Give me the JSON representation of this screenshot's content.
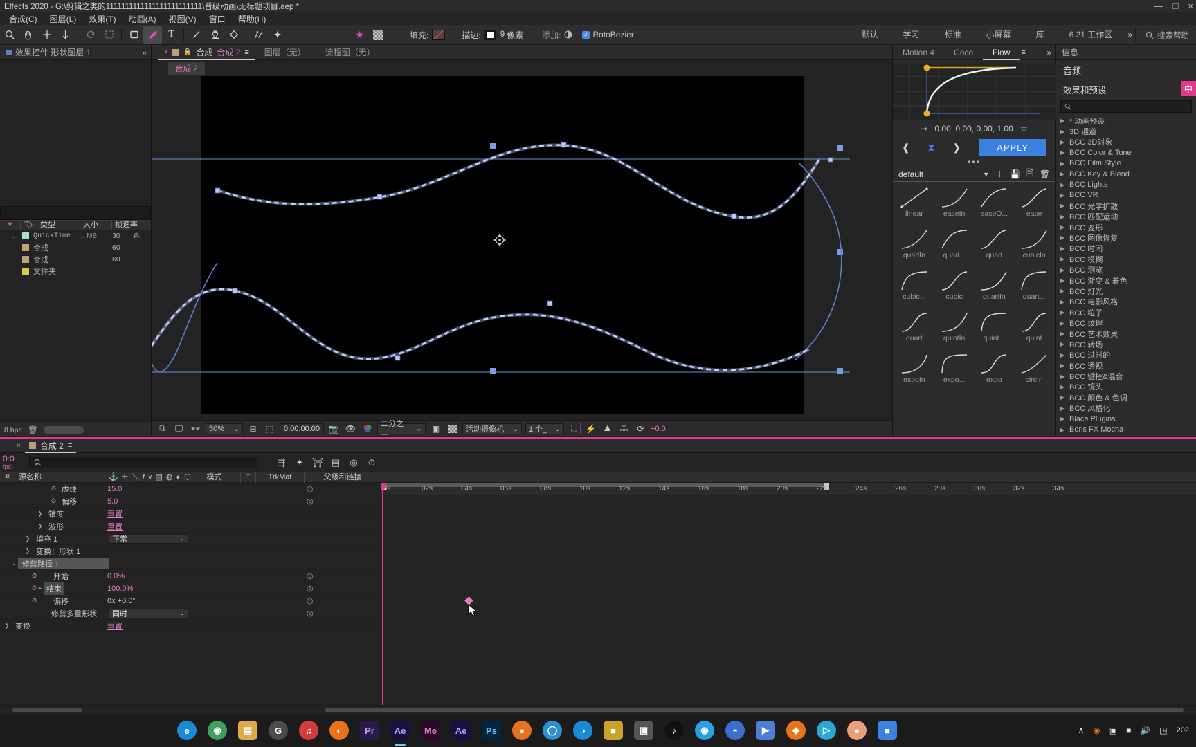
{
  "window": {
    "title": "Effects 2020 - G:\\剪辑之类的1111111111111111111111111\\晋级动画\\无标题项目.aep *",
    "buttons": [
      "—",
      "□",
      "×"
    ]
  },
  "menubar": {
    "items": [
      "合成(C)",
      "图层(L)",
      "效果(T)",
      "动画(A)",
      "视图(V)",
      "窗口",
      "帮助(H)"
    ]
  },
  "toolbar": {
    "tools": [
      {
        "name": "zoom-tool",
        "glyph": "⌕"
      },
      {
        "name": "hand-tool",
        "glyph": "✋"
      },
      {
        "name": "orbit-tool",
        "glyph": "✣"
      },
      {
        "name": "pan-behind-tool",
        "glyph": "↧"
      },
      {
        "name": "rotation-tool",
        "glyph": "↺"
      },
      {
        "name": "region-of-interest-tool",
        "glyph": "⛶"
      },
      {
        "name": "rectangle-tool",
        "glyph": "□"
      },
      {
        "name": "pen-tool",
        "glyph": "✒"
      },
      {
        "name": "type-tool",
        "glyph": "T"
      },
      {
        "name": "brush-tool",
        "glyph": "╱"
      },
      {
        "name": "clone-stamp-tool",
        "glyph": "⚓"
      },
      {
        "name": "eraser-tool",
        "glyph": "◆"
      },
      {
        "name": "roto-brush-tool",
        "glyph": "✎"
      },
      {
        "name": "puppet-pin-tool",
        "glyph": "✦"
      }
    ],
    "fill_label": "填充:",
    "stroke_label": "描边:",
    "stroke_width": "9",
    "stroke_unit": "像素",
    "add_label": "添加:",
    "rotobezier_label": "RotoBezier",
    "rotobezier_checked": true
  },
  "workspaces": {
    "items": [
      "默认",
      "学习",
      "标准",
      "小屏幕",
      "库",
      "6.21 工作区"
    ],
    "search_placeholder": "搜索帮助"
  },
  "effect_controls": {
    "tab_label": "效果控件 形状图层 1",
    "expand_glyph": "»"
  },
  "project_panel": {
    "columns": [
      "类型",
      "大小",
      "帧速率"
    ],
    "rows": [
      {
        "color": "#a8ded6",
        "type": "QuickTime",
        "size": "... MB",
        "fps": "30"
      },
      {
        "color": "#c0a275",
        "type": "合成",
        "size": "",
        "fps": "60"
      },
      {
        "color": "#c0a275",
        "type": "合成",
        "size": "",
        "fps": "60"
      },
      {
        "color": "#d6c84a",
        "type": "文件夹",
        "size": "",
        "fps": ""
      }
    ],
    "bit_depth": "8 bpc"
  },
  "comp_viewer": {
    "tabs": [
      {
        "label_prefix": "合成",
        "label_name": "合成 2",
        "active": true
      },
      {
        "label": "图层（无）",
        "active": false
      },
      {
        "label": "流程图（无）",
        "active": false
      }
    ],
    "breadcrumb": "合成 2",
    "bottom": {
      "zoom": "50%",
      "time": "0:00:00:00",
      "resolution": "二分之一",
      "camera": "活动摄像机",
      "views": "1 个_",
      "exposure": "+0.0"
    }
  },
  "flow_panel": {
    "tabs": [
      {
        "label": "Motion 4",
        "active": false
      },
      {
        "label": "Coco",
        "active": false
      },
      {
        "label": "Flow",
        "active": true
      }
    ],
    "bezier_values": "0.00, 0.00, 0.00, 1.00",
    "apply_label": "APPLY",
    "preset_set": "default",
    "presets": [
      "linear",
      "easeIn",
      "easeO...",
      "ease",
      "quadIn",
      "quad...",
      "quad",
      "cubicIn",
      "cubic...",
      "cubic",
      "quartIn",
      "quart...",
      "quart",
      "quintIn",
      "quint...",
      "quint",
      "expoIn",
      "expo...",
      "expo",
      "circIn"
    ]
  },
  "effects_presets": {
    "tab_label": "信息",
    "audio_label": "音频",
    "panel_title": "效果和预设",
    "badge": "中",
    "search_placeholder": "",
    "items": [
      "* 动画预设",
      "3D 通道",
      "BCC 3D对象",
      "BCC Color & Tone",
      "BCC Film Style",
      "BCC Key & Blend",
      "BCC Lights",
      "BCC VR",
      "BCC 光学扩散",
      "BCC 匹配运动",
      "BCC 变形",
      "BCC 图像恢复",
      "BCC 时间",
      "BCC 模糊",
      "BCC 测览",
      "BCC 渐变 & 着色",
      "BCC 灯光",
      "BCC 电影风格",
      "BCC 粒子",
      "BCC 纹理",
      "BCC 艺术效果",
      "BCC 转场",
      "BCC 过时的",
      "BCC 透视",
      "BCC 键控&混合",
      "BCC 镜头",
      "BCC 颜色 & 色调",
      "BCC 风格化",
      "Blace Plugins",
      "Boris FX Mocha"
    ]
  },
  "timeline": {
    "tab_label": "合成 2",
    "current_time": "0:0",
    "fps_note": "fps)",
    "search_placeholder": "",
    "columns": [
      "#",
      "源名称",
      "模式",
      "T",
      "TrkMat",
      "父级和链接"
    ],
    "rows": [
      {
        "indent": 3,
        "stopwatch": true,
        "name": "虚线",
        "value": "15.0",
        "value_color": "#e579c8",
        "type": "value",
        "link": true
      },
      {
        "indent": 3,
        "stopwatch": true,
        "name": "偏移",
        "value": "5.0",
        "value_color": "#e579c8",
        "type": "value",
        "link": true
      },
      {
        "indent": 2,
        "arrow": true,
        "name": "锥度",
        "value": "重置",
        "type": "reset"
      },
      {
        "indent": 2,
        "arrow": true,
        "name": "波形",
        "value": "重置",
        "type": "reset"
      },
      {
        "indent": 1,
        "arrow": true,
        "name": "填充 1",
        "value": "正常",
        "type": "dropdown"
      },
      {
        "indent": 1,
        "arrow": true,
        "name": "变换：形状 1",
        "value": "",
        "type": "none"
      },
      {
        "indent": 0,
        "arrowdown": true,
        "name": "修剪路径 1",
        "value": "",
        "type": "none",
        "selected": true
      },
      {
        "indent": 2,
        "stopwatch": true,
        "name": "开始",
        "value": "0.0%",
        "value_color": "#e579c8",
        "type": "value",
        "link": true
      },
      {
        "indent": 2,
        "stopwatch": true,
        "graph": true,
        "name": "结束",
        "value": "100.0%",
        "value_color": "#e579c8",
        "type": "value",
        "link": true,
        "highlight": true
      },
      {
        "indent": 2,
        "stopwatch": true,
        "name": "偏移",
        "value": "0x +0.0°",
        "value_color": "#c5c5c5",
        "type": "value",
        "link": true
      },
      {
        "indent": 2,
        "name": "修剪多重形状",
        "value": "同时",
        "type": "dropdown"
      },
      {
        "indent": 0,
        "arrow": true,
        "name": "变换",
        "value": "重置",
        "type": "reset"
      }
    ],
    "ruler_ticks": [
      "0s",
      "02s",
      "04s",
      "06s",
      "08s",
      "10s",
      "12s",
      "14s",
      "16s",
      "18s",
      "20s",
      "22s",
      "24s",
      "26s",
      "28s",
      "30s",
      "32s",
      "34s"
    ],
    "keyframe_time": "04s"
  },
  "taskbar": {
    "apps": [
      {
        "name": "edge",
        "label": "e",
        "color": "#1b8ad6"
      },
      {
        "name": "search",
        "label": "●",
        "color": "#3f9e5e"
      },
      {
        "name": "file-explorer",
        "label": "▤",
        "color": "#e0a94a"
      },
      {
        "name": "chrome-canary",
        "label": "G",
        "color": "#4b4b4b"
      },
      {
        "name": "music-app",
        "label": "♫",
        "color": "#d63b3b"
      },
      {
        "name": "firefox",
        "label": "◐",
        "color": "#e8731a"
      },
      {
        "name": "premiere-pro",
        "label": "Pr",
        "color": "#2a1a4a"
      },
      {
        "name": "after-effects",
        "label": "Ae",
        "color": "#1a1040"
      },
      {
        "name": "media-encoder",
        "label": "Me",
        "color": "#2a0a2a"
      },
      {
        "name": "after-effects-2",
        "label": "Ae",
        "color": "#1a1040"
      },
      {
        "name": "photoshop",
        "label": "Ps",
        "color": "#04253f"
      },
      {
        "name": "blender",
        "label": "●",
        "color": "#e87d0d"
      },
      {
        "name": "browser-2",
        "label": "◯",
        "color": "#2d8fd0"
      },
      {
        "name": "edge-beta",
        "label": "◑",
        "color": "#1b8ad6"
      },
      {
        "name": "app-yellow",
        "label": "■",
        "color": "#c9a227"
      },
      {
        "name": "camera-app",
        "label": "▣",
        "color": "#555"
      },
      {
        "name": "tiktok",
        "label": "♪",
        "color": "#111"
      },
      {
        "name": "wechat",
        "label": "◉",
        "color": "#2aa0e0"
      },
      {
        "name": "qq",
        "label": "◓",
        "color": "#3a6fd0"
      },
      {
        "name": "recorder",
        "label": "▶",
        "color": "#4b7fd4"
      },
      {
        "name": "app-orange",
        "label": "◆",
        "color": "#e8731a"
      },
      {
        "name": "player-app",
        "label": "▷",
        "color": "#2aa8d8"
      },
      {
        "name": "app-peach",
        "label": "●",
        "color": "#e8a07a"
      },
      {
        "name": "app-blue",
        "label": "■",
        "color": "#3b82e0"
      }
    ],
    "tray": {
      "chevron": "∧",
      "icons": [
        "◉",
        "▣",
        "■",
        "◆"
      ],
      "volume": "🔊",
      "network": "◳",
      "date": "202",
      "time": ""
    }
  }
}
